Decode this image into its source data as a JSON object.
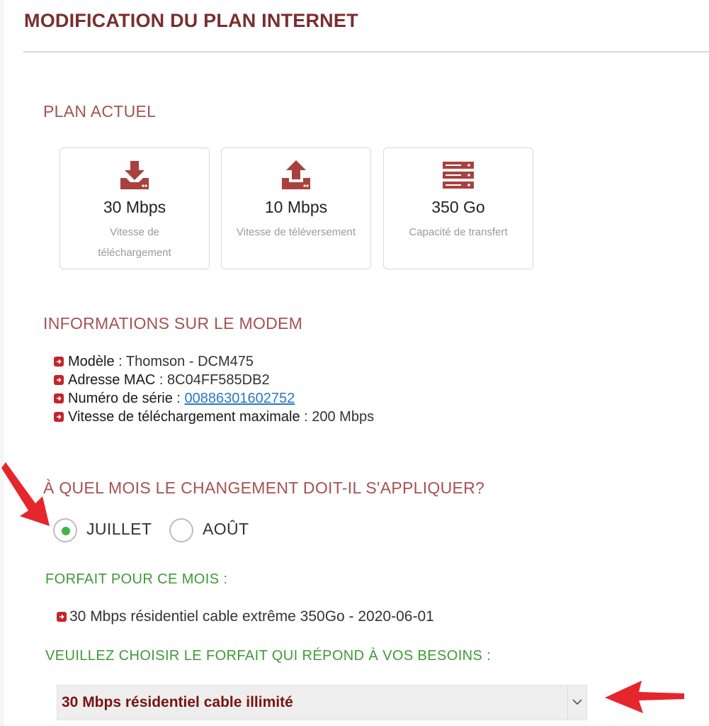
{
  "page": {
    "title": "MODIFICATION DU PLAN INTERNET"
  },
  "current_plan": {
    "heading": "PLAN ACTUEL",
    "cards": [
      {
        "icon": "download-icon",
        "value": "30 Mbps",
        "label": "Vitesse de téléchargement"
      },
      {
        "icon": "upload-icon",
        "value": "10 Mbps",
        "label": "Vitesse de téléversement"
      },
      {
        "icon": "server-storage-icon",
        "value": "350 Go",
        "label": "Capacité de transfert"
      }
    ]
  },
  "modem": {
    "heading": "INFORMATIONS SUR LE MODEM",
    "rows": [
      {
        "key": "Modèle",
        "sep": " : ",
        "value": "Thomson - DCM475"
      },
      {
        "key": "Adresse MAC",
        "sep": " : ",
        "value": "8C04FF585DB2"
      },
      {
        "key": "Numéro de série",
        "sep": " : ",
        "value": "00886301602752"
      },
      {
        "key": "Vitesse de téléchargement maximale",
        "sep": " : ",
        "value": "200 Mbps"
      }
    ]
  },
  "month_choice": {
    "heading": "À QUEL MOIS LE CHANGEMENT DOIT-IL S'APPLIQUER?",
    "options": [
      {
        "label": "JUILLET",
        "selected": true
      },
      {
        "label": "AOÛT",
        "selected": false
      }
    ]
  },
  "plan_this_month": {
    "heading": "FORFAIT POUR CE MOIS :",
    "value": "30 Mbps résidentiel cable extrême 350Go - 2020-06-01"
  },
  "plan_choice": {
    "heading": "VEUILLEZ CHOISIR LE FORFAIT QUI RÉPOND À VOS BESOINS :",
    "selected": "30 Mbps résidentiel cable illimité"
  },
  "colors": {
    "title": "#7a2e2e",
    "section_heading": "#a55252",
    "green_heading": "#3f9a36",
    "icon": "#a8413f",
    "bullet": "#c4252b",
    "radio_selected": "#3cb44b",
    "link": "#2a78c4",
    "annotation_arrow": "#e5262c"
  }
}
